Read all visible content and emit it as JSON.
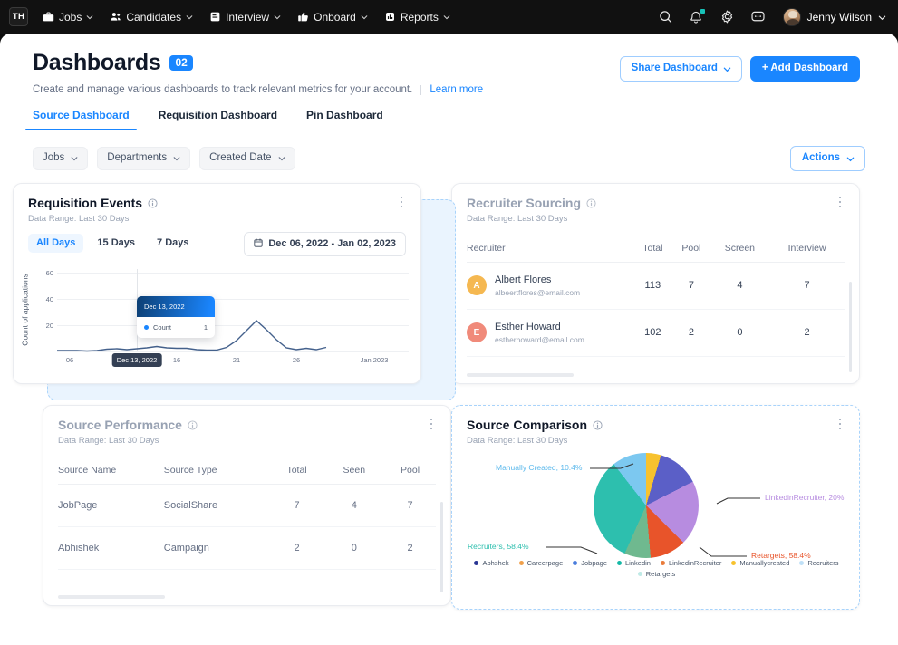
{
  "topnav": {
    "logo": "TH",
    "items": [
      {
        "label": "Jobs",
        "icon": "briefcase-icon"
      },
      {
        "label": "Candidates",
        "icon": "people-icon"
      },
      {
        "label": "Interview",
        "icon": "note-icon"
      },
      {
        "label": "Onboard",
        "icon": "thumbs-up-icon"
      },
      {
        "label": "Reports",
        "icon": "report-icon"
      }
    ],
    "right_icons": [
      "search-icon",
      "bell-icon",
      "gear-icon",
      "chat-icon"
    ],
    "user": "Jenny Wilson"
  },
  "header": {
    "title": "Dashboards",
    "count_badge": "02",
    "description": "Create and manage various dashboards to track relevant metrics for your account.",
    "learn_more": "Learn more",
    "share_button": "Share Dashboard",
    "add_button": "+ Add Dashboard"
  },
  "tabs": [
    {
      "label": "Source Dashboard",
      "active": true
    },
    {
      "label": "Requisition Dashboard",
      "active": false
    },
    {
      "label": "Pin Dashboard",
      "active": false
    }
  ],
  "filters": {
    "chips": [
      "Jobs",
      "Departments",
      "Created Date"
    ],
    "actions": "Actions"
  },
  "cards": {
    "requisition_events": {
      "title": "Requisition Events",
      "subtitle": "Data Range: Last 30 Days",
      "segments": [
        {
          "label": "All Days",
          "active": true
        },
        {
          "label": "15 Days",
          "active": false
        },
        {
          "label": "7 Days",
          "active": false
        }
      ],
      "date_range": "Dec 06, 2022 - Jan 02, 2023",
      "tooltip": {
        "date": "Dec 13, 2022",
        "series": "Count",
        "value": "1"
      },
      "axis_highlight": "Dec 13, 2022"
    },
    "recruiter_sourcing": {
      "title": "Recruiter Sourcing",
      "subtitle": "Data Range: Last 30 Days",
      "columns": [
        "Recruiter",
        "Total",
        "Pool",
        "Screen",
        "Interview"
      ],
      "rows": [
        {
          "initial": "A",
          "color": "#f5b851",
          "name": "Albert Flores",
          "email": "albeertflores@email.com",
          "total": "113",
          "pool": "7",
          "screen": "4",
          "interview": "7"
        },
        {
          "initial": "E",
          "color": "#f08a7a",
          "name": "Esther Howard",
          "email": "estherhoward@email.com",
          "total": "102",
          "pool": "2",
          "screen": "0",
          "interview": "2"
        }
      ]
    },
    "source_performance": {
      "title": "Source Performance",
      "subtitle": "Data Range: Last 30 Days",
      "columns": [
        "Source Name",
        "Source Type",
        "Total",
        "Seen",
        "Pool"
      ],
      "rows": [
        {
          "name": "JobPage",
          "type": "SocialShare",
          "total": "7",
          "seen": "4",
          "pool": "7"
        },
        {
          "name": "Abhishek",
          "type": "Campaign",
          "total": "2",
          "seen": "0",
          "pool": "2"
        }
      ]
    },
    "source_comparison": {
      "title": "Source Comparison",
      "subtitle": "Data Range: Last 30 Days"
    }
  },
  "chart_data": [
    {
      "type": "line",
      "title": "Requisition Events",
      "xlabel": "",
      "ylabel": "Count of applications",
      "ylim": [
        0,
        70
      ],
      "yticks": [
        20,
        40,
        60
      ],
      "xticks": [
        "06",
        "Dec 13, 2022",
        "16",
        "21",
        "26",
        "Jan 2023"
      ],
      "grid": true,
      "legend": "none",
      "series": [
        {
          "name": "Count",
          "color": "#44618c",
          "x": [
            "06",
            "07",
            "08",
            "09",
            "10",
            "11",
            "12",
            "13",
            "14",
            "15",
            "16",
            "17",
            "18",
            "19",
            "20",
            "21",
            "22",
            "23",
            "24",
            "25",
            "26",
            "27",
            "28",
            "29",
            "30",
            "31",
            "Jan 01",
            "Jan 02"
          ],
          "values": [
            1,
            1,
            1,
            1,
            1,
            2,
            2,
            1,
            2,
            2,
            3,
            2,
            2,
            2,
            1,
            1,
            1,
            6,
            14,
            22,
            27,
            20,
            13,
            5,
            3,
            4,
            3,
            5
          ]
        }
      ],
      "annotation": {
        "date": "Dec 13, 2022",
        "count": 1
      }
    },
    {
      "type": "pie",
      "title": "Source Comparison",
      "legend_position": "bottom",
      "labels": [
        "Abhshek",
        "Careerpage",
        "Jobpage",
        "Linkedin",
        "LinkedinRecruiter",
        "Manuallycreated",
        "Recruiters",
        "Retargets"
      ],
      "colors": [
        "#3b4c9e",
        "#6f72c4",
        "#b78ce0",
        "#e8542a",
        "#6fb98f",
        "#2dbfae",
        "#7cc8f0",
        "#f7c22e"
      ],
      "callouts": [
        {
          "label": "Manually Created, 10.4%",
          "color": "#5cb9ec"
        },
        {
          "label": "LinkedinRecruiter, 20%",
          "color": "#b78ce0"
        },
        {
          "label": "Retargets, 58.4%",
          "color": "#e8542a"
        },
        {
          "label": "Recruiters, 58.4%",
          "color": "#2dbfae"
        }
      ],
      "legend_entries": [
        {
          "label": "Abhshek",
          "color": "#283593"
        },
        {
          "label": "Careerpage",
          "color": "#f0a04b"
        },
        {
          "label": "Jobpage",
          "color": "#4a7ddc"
        },
        {
          "label": "Linkedin",
          "color": "#14b8a6"
        },
        {
          "label": "LinkedinRecruiter",
          "color": "#e97c3c"
        },
        {
          "label": "Manuallycreated",
          "color": "#f7c22e"
        },
        {
          "label": "Recruiters",
          "color": "#bfe0f7"
        },
        {
          "label": "Retargets",
          "color": "#bfeae6"
        }
      ],
      "slices": [
        {
          "label": "Abhshek",
          "value": 13.0,
          "color": "#5b5fc7"
        },
        {
          "label": "LinkedinRecruiter",
          "value": 20.0,
          "color": "#b78ce0"
        },
        {
          "label": "Retargets",
          "value": 11.0,
          "color": "#e8542a"
        },
        {
          "label": "Careerpage",
          "value": 8.0,
          "color": "#6fb98f"
        },
        {
          "label": "Recruiters",
          "value": 33.0,
          "color": "#2dbfae"
        },
        {
          "label": "Manually Created",
          "value": 10.4,
          "color": "#7cc8f0"
        },
        {
          "label": "Jobpage",
          "value": 4.6,
          "color": "#f7c22e"
        }
      ]
    }
  ]
}
